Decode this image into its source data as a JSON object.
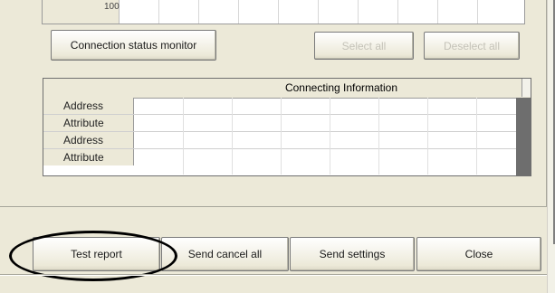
{
  "top_grid": {
    "row_value": "100"
  },
  "buttons": {
    "connection_status_monitor": "Connection status monitor",
    "select_all": "Select all",
    "deselect_all": "Deselect all",
    "test_report": "Test report",
    "send_cancel_all": "Send cancel all",
    "send_settings": "Send settings",
    "close": "Close"
  },
  "connecting_info": {
    "title": "Connecting Information",
    "rows": [
      "Address",
      "Attribute",
      "Address",
      "Attribute"
    ]
  }
}
